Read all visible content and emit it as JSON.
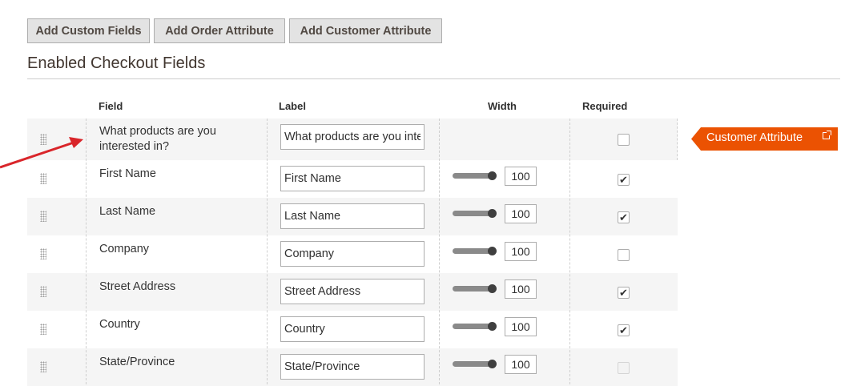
{
  "toolbar": {
    "buttons": [
      {
        "label": "Add Custom Fields"
      },
      {
        "label": "Add Order Attribute"
      },
      {
        "label": "Add Customer Attribute"
      }
    ]
  },
  "section": {
    "title": "Enabled Checkout Fields"
  },
  "table": {
    "columns": {
      "field": "Field",
      "label": "Label",
      "width": "Width",
      "required": "Required"
    },
    "rows": [
      {
        "field": "What products are you interested in?",
        "label_value": "What products are you interested in?",
        "has_width": false,
        "required": false
      },
      {
        "field": "First Name",
        "label_value": "First Name",
        "has_width": true,
        "width": "100",
        "required": true
      },
      {
        "field": "Last Name",
        "label_value": "Last Name",
        "has_width": true,
        "width": "100",
        "required": true
      },
      {
        "field": "Company",
        "label_value": "Company",
        "has_width": true,
        "width": "100",
        "required": false
      },
      {
        "field": "Street Address",
        "label_value": "Street Address",
        "has_width": true,
        "width": "100",
        "required": true
      },
      {
        "field": "Country",
        "label_value": "Country",
        "has_width": true,
        "width": "100",
        "required": true
      },
      {
        "field": "State/Province",
        "label_value": "State/Province",
        "has_width": true,
        "width": "100",
        "required": false,
        "disabled": true
      }
    ]
  },
  "badge": {
    "label": "Customer Attribute",
    "icon": "external-link-icon",
    "color": "#eb5202"
  },
  "arrow": {
    "color": "#d9252a"
  }
}
